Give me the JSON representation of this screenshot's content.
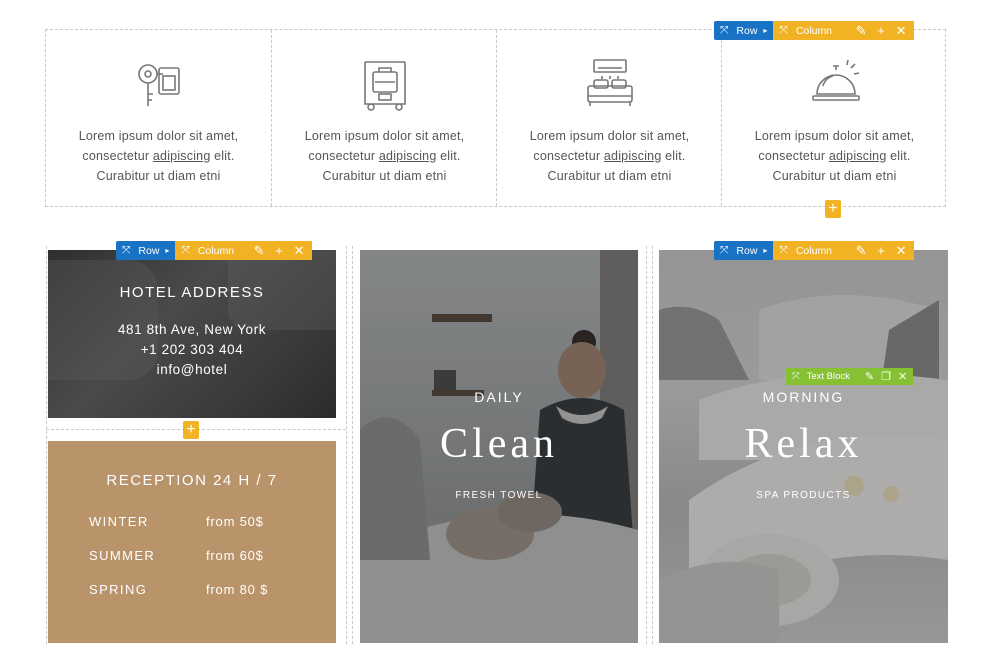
{
  "features": [
    {
      "icon": "key-icon",
      "line1": "Lorem ipsum dolor sit amet,",
      "line2_pre": "consectetur ",
      "line2_link": "adipiscing",
      "line2_post": " elit.",
      "line3": "Curabitur ut diam etni"
    },
    {
      "icon": "luggage-cart-icon",
      "line1": "Lorem ipsum dolor sit amet,",
      "line2_pre": "consectetur ",
      "line2_link": "adipiscing",
      "line2_post": " elit.",
      "line3": "Curabitur ut diam etni"
    },
    {
      "icon": "bed-ac-icon",
      "line1": "Lorem ipsum dolor sit amet,",
      "line2_pre": "consectetur ",
      "line2_link": "adipiscing",
      "line2_post": " elit.",
      "line3": "Curabitur ut diam etni"
    },
    {
      "icon": "service-bell-icon",
      "line1": "Lorem ipsum dolor sit amet,",
      "line2_pre": "consectetur ",
      "line2_link": "adipiscing",
      "line2_post": " elit.",
      "line3": "Curabitur ut diam etni"
    }
  ],
  "toolbar": {
    "row_label": "Row",
    "column_label": "Column",
    "text_block_label": "Text Block"
  },
  "address": {
    "title": "HOTEL ADDRESS",
    "street": "481 8th Ave, New York",
    "phone": "+1 202 303 404",
    "email": "info@hotel"
  },
  "reception": {
    "title": "RECEPTION 24 H / 7",
    "rates": [
      {
        "season": "WINTER",
        "price": "from 50$"
      },
      {
        "season": "SUMMER",
        "price": "from 60$"
      },
      {
        "season": "SPRING",
        "price": "from 80 $"
      }
    ]
  },
  "clean": {
    "label": "DAILY",
    "heading": "Clean",
    "sub": "FRESH TOWEL"
  },
  "relax": {
    "label": "MORNING",
    "heading": "Relax",
    "sub": "SPA PRODUCTS"
  },
  "colors": {
    "row": "#1a72c4",
    "column": "#f1b224",
    "text_block": "#86c033",
    "reception_bg": "#b99369"
  }
}
